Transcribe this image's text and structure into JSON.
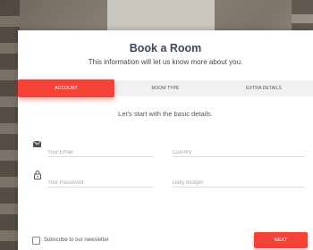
{
  "header": {
    "title": "Book a Room",
    "subtitle": "This information will let us know more about you."
  },
  "tabs": [
    {
      "label": "ACCOUNT",
      "active": true
    },
    {
      "label": "ROOM TYPE",
      "active": false
    },
    {
      "label": "EXTRA DETAILS",
      "active": false
    }
  ],
  "step": {
    "lead": "Let's start with the basic details."
  },
  "form": {
    "email_placeholder": "Your Email",
    "country_placeholder": "Country",
    "password_placeholder": "Your Password",
    "budget_placeholder": "Daily Budget",
    "newsletter_label": "Subscribe to our newsletter",
    "newsletter_checked": false
  },
  "footer": {
    "next_label": "NEXT"
  },
  "colors": {
    "accent": "#f44336",
    "title": "#3c4858"
  },
  "icons": {
    "email": "mail-icon",
    "password": "lock-icon"
  }
}
